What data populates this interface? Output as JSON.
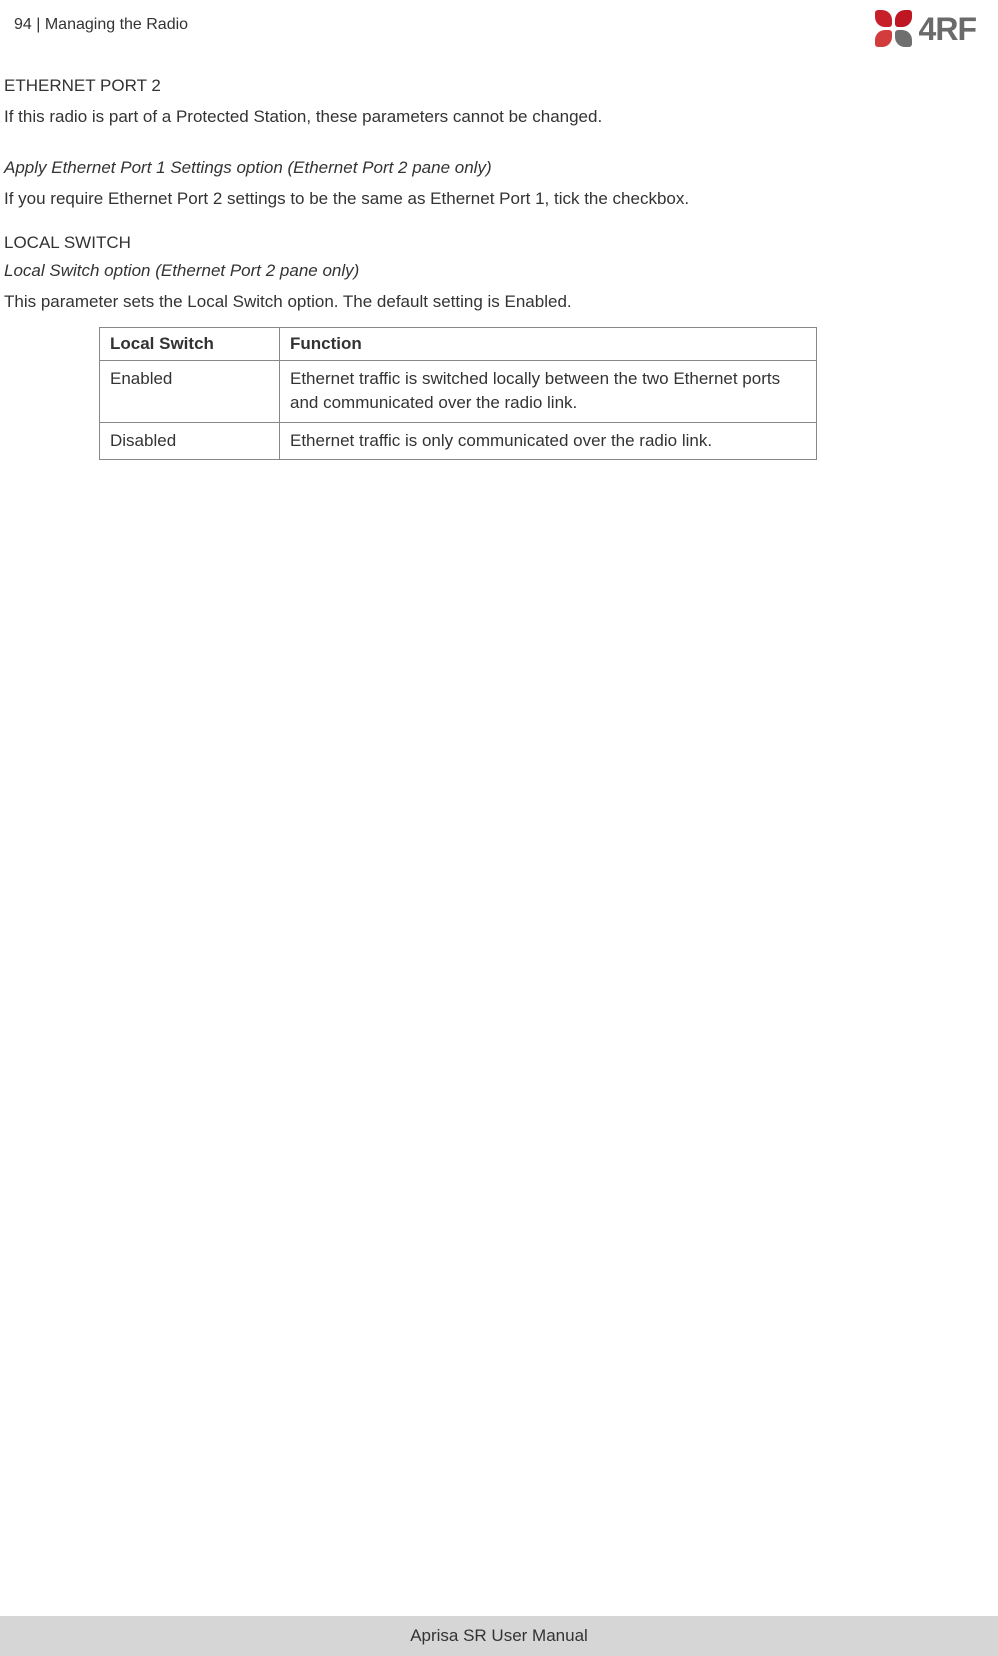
{
  "header": {
    "page_number": "94",
    "separator": "  |  ",
    "section_title": "Managing the Radio",
    "logo_text": "4RF"
  },
  "content": {
    "heading1": "ETHERNET PORT 2",
    "para1": "If this radio is part of a Protected Station, these parameters cannot be changed.",
    "italic1": "Apply Ethernet Port 1 Settings option (Ethernet Port 2 pane only)",
    "para2": "If you require Ethernet Port 2 settings to be the same as Ethernet Port 1, tick the checkbox.",
    "heading2": "LOCAL SWITCH",
    "italic2": "Local Switch option (Ethernet Port 2 pane only)",
    "para3": "This parameter sets the Local Switch option. The default setting is Enabled.",
    "table": {
      "headers": [
        "Local Switch",
        "Function"
      ],
      "rows": [
        [
          "Enabled",
          "Ethernet traffic is switched locally between the two Ethernet ports and communicated over the radio link."
        ],
        [
          "Disabled",
          "Ethernet traffic is only communicated over the radio link."
        ]
      ]
    }
  },
  "footer": {
    "text": "Aprisa SR User Manual"
  }
}
